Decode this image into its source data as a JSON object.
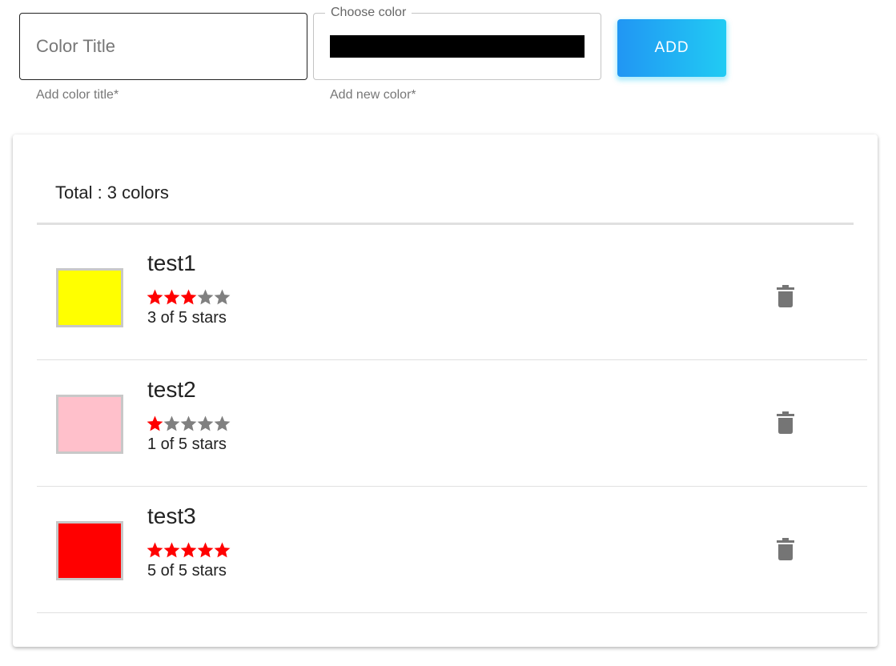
{
  "form": {
    "title_placeholder": "Color Title",
    "title_value": "",
    "title_helper": "Add color title*",
    "color_legend": "Choose color",
    "color_value": "#000000",
    "color_helper": "Add new color*",
    "add_label": "ADD"
  },
  "list": {
    "total_label": "Total : 3 colors",
    "items": [
      {
        "name": "test1",
        "color": "#ffff00",
        "rating": 3,
        "max_rating": 5,
        "rating_text": "3 of 5 stars",
        "delete_icon": "trash-icon"
      },
      {
        "name": "test2",
        "color": "#ffc0cb",
        "rating": 1,
        "max_rating": 5,
        "rating_text": "1 of 5 stars",
        "delete_icon": "trash-icon"
      },
      {
        "name": "test3",
        "color": "#ff0000",
        "rating": 5,
        "max_rating": 5,
        "rating_text": "5 of 5 stars",
        "delete_icon": "trash-icon"
      }
    ]
  },
  "colors": {
    "star_filled": "#ff0000",
    "star_empty": "#808080",
    "trash": "#757575",
    "button_gradient_start": "#2196f3",
    "button_gradient_end": "#21cbf3"
  }
}
